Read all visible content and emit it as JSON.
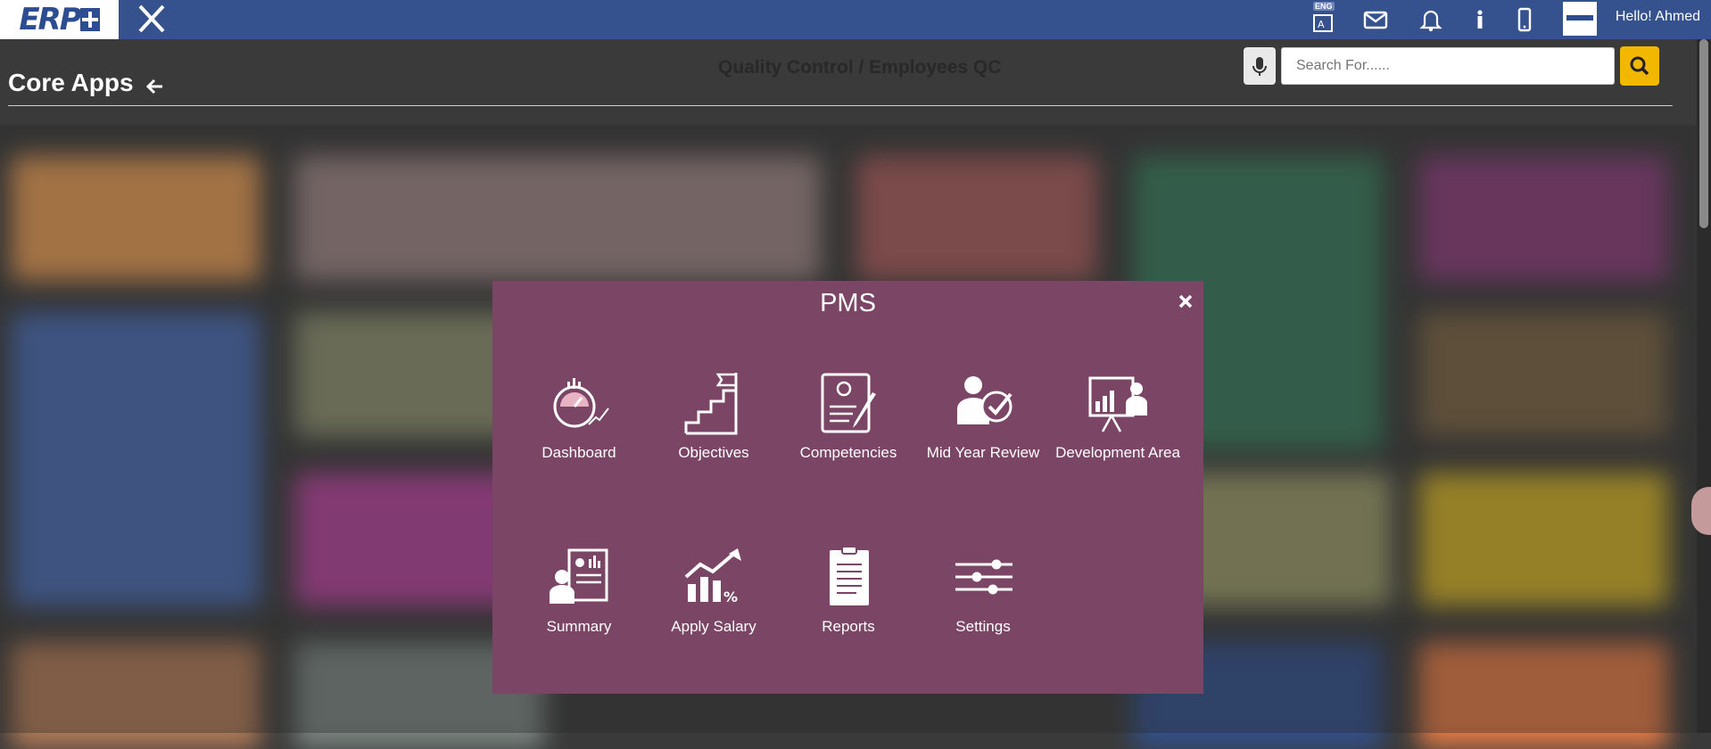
{
  "topbar": {
    "logo_text": "ERP",
    "language_badge": "ENG",
    "greeting": "Hello! Ahmed",
    "icons": [
      "language-icon",
      "mail-icon",
      "bell-icon",
      "info-icon",
      "phone-icon"
    ]
  },
  "header": {
    "title": "Core Apps",
    "breadcrumb": "Quality Control / Employees QC",
    "search_placeholder": "Search For......"
  },
  "modal": {
    "title": "PMS",
    "apps": [
      {
        "label": "Dashboard",
        "icon": "dashboard-icon"
      },
      {
        "label": "Objectives",
        "icon": "objectives-icon"
      },
      {
        "label": "Competencies",
        "icon": "competencies-icon"
      },
      {
        "label": "Mid Year Review",
        "icon": "mid-year-review-icon"
      },
      {
        "label": "Development Area",
        "icon": "development-area-icon"
      },
      {
        "label": "Summary",
        "icon": "summary-icon"
      },
      {
        "label": "Apply Salary",
        "icon": "apply-salary-icon"
      },
      {
        "label": "Reports",
        "icon": "reports-icon"
      },
      {
        "label": "Settings",
        "icon": "settings-icon"
      }
    ]
  },
  "colors": {
    "topbar": "#35528f",
    "modal": "#7b4565",
    "search_button": "#f2b800"
  }
}
